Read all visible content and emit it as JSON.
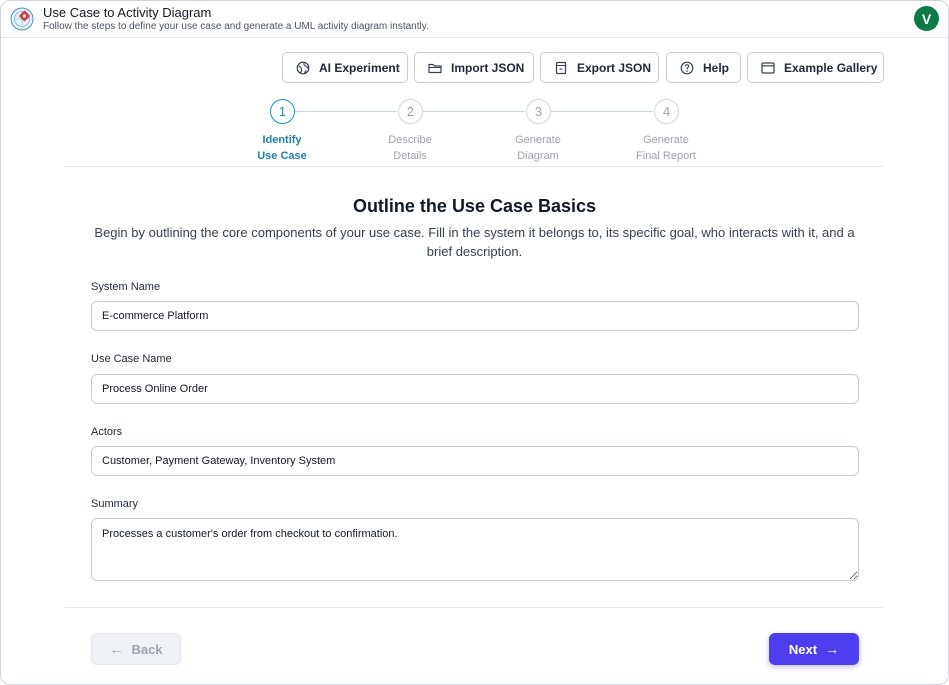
{
  "app": {
    "title": "Use Case to Activity Diagram",
    "subtitle": "Follow the steps to define your use case and generate a UML activity diagram instantly.",
    "avatar_initial": "V",
    "avatar_color": "#0e7a4a"
  },
  "toolbar": {
    "buttons": [
      {
        "label": "AI Experiment",
        "icon": "globe-icon"
      },
      {
        "label": "Import JSON",
        "icon": "folder-icon"
      },
      {
        "label": "Export JSON",
        "icon": "export-icon"
      },
      {
        "label": "Help",
        "icon": "help-icon"
      },
      {
        "label": "Example Gallery",
        "icon": "gallery-icon"
      }
    ]
  },
  "stepper": {
    "active_step": 1,
    "steps": [
      {
        "number": "1",
        "line1": "Identify",
        "line2": "Use Case"
      },
      {
        "number": "2",
        "line1": "Describe",
        "line2": "Details"
      },
      {
        "number": "3",
        "line1": "Generate",
        "line2": "Diagram"
      },
      {
        "number": "4",
        "line1": "Generate",
        "line2": "Final Report"
      }
    ]
  },
  "form": {
    "title": "Outline the Use Case Basics",
    "description": "Begin by outlining the core components of your use case. Fill in the system it belongs to, its specific goal, who interacts with it, and a brief description.",
    "system_name": {
      "label": "System Name",
      "value": "E-commerce Platform"
    },
    "use_case_name": {
      "label": "Use Case Name",
      "value": "Process Online Order"
    },
    "actors": {
      "label": "Actors",
      "value": "Customer, Payment Gateway, Inventory System"
    },
    "summary": {
      "label": "Summary",
      "value": "Processes a customer's order from checkout to confirmation."
    }
  },
  "footer": {
    "back_label": "Back",
    "next_label": "Next",
    "next_color": "#4f3df0"
  },
  "colors": {
    "accent": "#1d8fbf"
  }
}
